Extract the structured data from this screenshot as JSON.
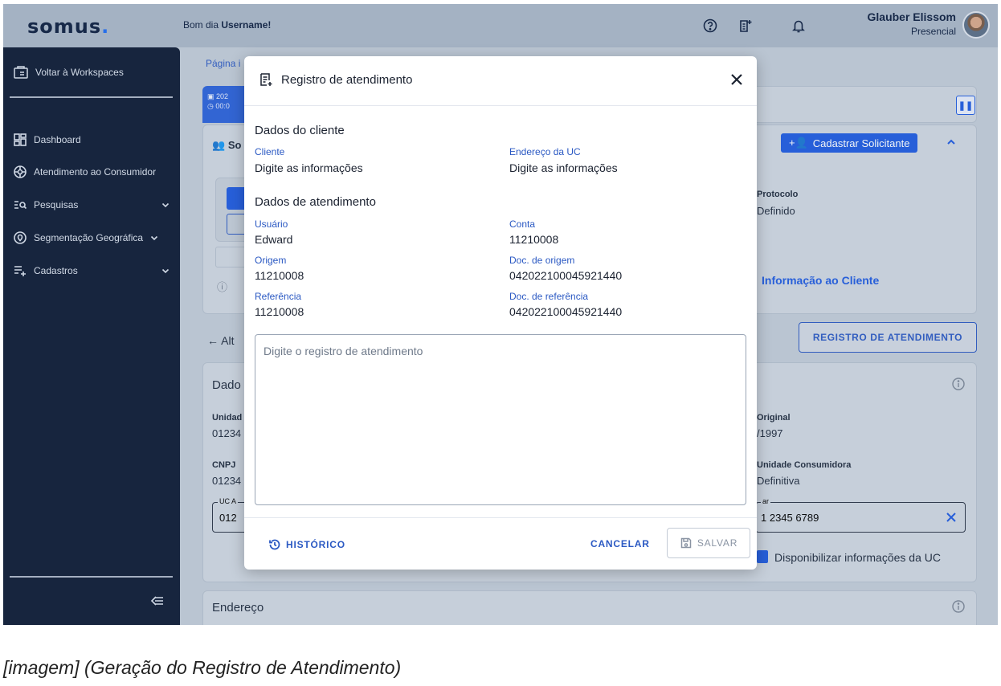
{
  "topbar": {
    "logo_text": "somus",
    "logo_dot": ".",
    "greeting_prefix": "Bom dia ",
    "greeting_user": "Username!",
    "user_name": "Glauber Elissom",
    "user_role": "Presencial"
  },
  "sidebar": {
    "back_label": "Voltar à Workspaces",
    "items": [
      {
        "label": "Dashboard",
        "icon": "dashboard-icon"
      },
      {
        "label": "Atendimento ao Consumidor",
        "icon": "support-icon"
      },
      {
        "label": "Pesquisas",
        "icon": "search-list-icon",
        "expandable": true
      },
      {
        "label": "Segmentação Geográfica",
        "icon": "location-icon",
        "expandable": true
      },
      {
        "label": "Cadastros",
        "icon": "add-list-icon",
        "expandable": true
      }
    ]
  },
  "background": {
    "breadcrumb": "Página i",
    "tab_date": "202",
    "tab_time": "00:0",
    "section_so": "So",
    "cadastrar_solicitante": "Cadastrar Solicitante",
    "protocolo_label": "Protocolo",
    "protocolo_value": "Definido",
    "informacao_cliente": "Informação ao Cliente",
    "back_link": "Alt",
    "registro_button": "REGISTRO DE ATENDIMENTO",
    "dados_title": "Dado",
    "unidade_label": "Unidad",
    "unidade_value": "01234",
    "original_label": "Original",
    "original_value": "/1997",
    "cnpj_label": "CNPJ",
    "cnpj_value": "01234",
    "tipo_uc_label": "Unidade Consumidora",
    "tipo_uc_value": "Definitiva",
    "uc_field_label": "UC A",
    "uc_field_value": "012",
    "phone_field_label": "ar",
    "phone_value": "1 2345 6789",
    "checkbox_label": "Disponibilizar informações da UC",
    "endereco_title": "Endereço"
  },
  "modal": {
    "title": "Registro de atendimento",
    "cliente_section": "Dados do cliente",
    "cliente_label": "Cliente",
    "cliente_value": "Digite as informações",
    "endereco_label": "Endereço da UC",
    "endereco_value": "Digite as informações",
    "atendimento_section": "Dados de atendimento",
    "usuario_label": "Usuário",
    "usuario_value": "Edward",
    "conta_label": "Conta",
    "conta_value": "11210008",
    "origem_label": "Origem",
    "origem_value": "11210008",
    "doc_origem_label": "Doc. de origem",
    "doc_origem_value": "042022100045921440",
    "referencia_label": "Referência",
    "referencia_value": "11210008",
    "doc_referencia_label": "Doc. de referência",
    "doc_referencia_value": "042022100045921440",
    "textarea_placeholder": "Digite o registro de atendimento",
    "historico_label": "HISTÓRICO",
    "cancelar_label": "CANCELAR",
    "salvar_label": "SALVAR"
  },
  "caption": "[imagem] (Geração do Registro de Atendimento)",
  "colors": {
    "sidebar_bg": "#0d1a34",
    "accent": "#1f5be0",
    "link": "#2b59c3"
  }
}
